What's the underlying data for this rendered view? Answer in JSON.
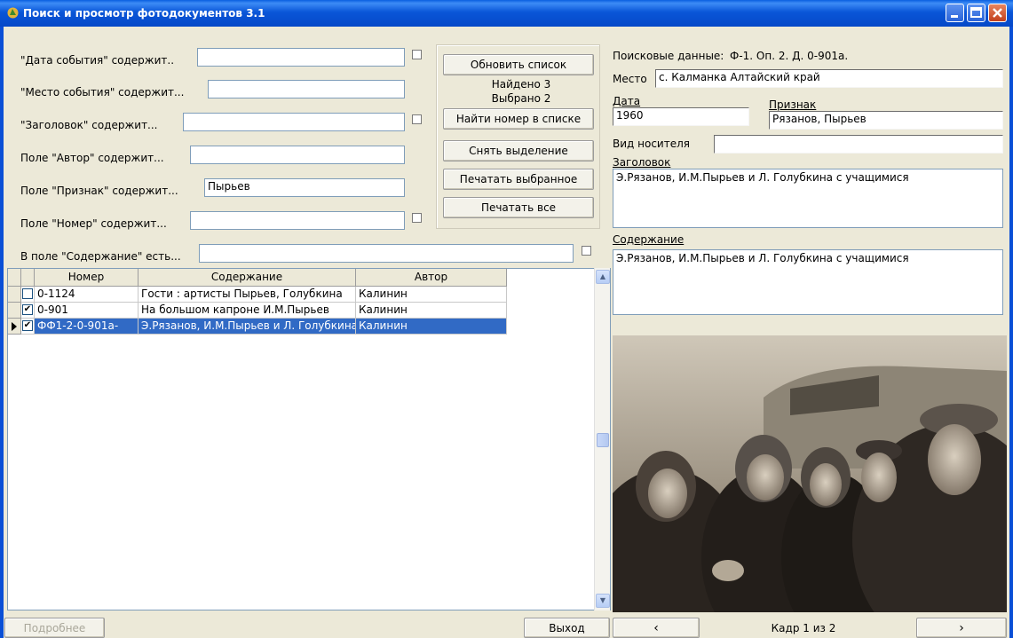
{
  "window": {
    "title": "Поиск и просмотр фотодокументов 3.1"
  },
  "filters": {
    "date_label": "\"Дата события\" содержит..",
    "date_value": "",
    "place_label": "\"Место события\" содержит...",
    "place_value": "",
    "title_label": "\"Заголовок\" содержит...",
    "title_value": "",
    "author_label": "Поле \"Автор\" содержит...",
    "author_value": "",
    "sign_label": "Поле \"Признак\" содержит...",
    "sign_value": "Пырьев",
    "number_label": "Поле \"Номер\" содержит...",
    "number_value": "",
    "content_label": "В поле \"Содержание\" есть...",
    "content_value": ""
  },
  "actions": {
    "refresh_label": "Обновить список",
    "found_text": "Найдено 3",
    "selected_text": "Выбрано 2",
    "find_number_label": "Найти номер в списке",
    "deselect_label": "Снять выделение",
    "print_selected_label": "Печатать выбранное",
    "print_all_label": "Печатать все"
  },
  "grid": {
    "columns": [
      "Номер",
      "Содержание",
      "Автор"
    ],
    "rows": [
      {
        "checked": false,
        "current": false,
        "number": "0-1124",
        "content": "Гости : артисты Пырьев, Голубкина",
        "author": "Калинин"
      },
      {
        "checked": true,
        "current": false,
        "number": "0-901",
        "content": "На большом капроне И.М.Пырьев",
        "author": "Калинин"
      },
      {
        "checked": true,
        "current": true,
        "number": "ФФ1-2-0-901а-",
        "content": "Э.Рязанов, И.М.Пырьев и Л. Голубкина",
        "author": "Калинин"
      }
    ]
  },
  "details": {
    "search_data_label": "Поисковые данные:",
    "search_data_value": "Ф-1. Оп. 2. Д. 0-901а.",
    "place_label": "Место",
    "place_value": "с. Калманка Алтайский край",
    "date_label": "Дата",
    "date_value": "1960",
    "sign_label": "Признак",
    "sign_value": "Рязанов, Пырьев",
    "media_label": "Вид носителя",
    "media_value": "",
    "title_label": "Заголовок",
    "title_value": "Э.Рязанов, И.М.Пырьев и Л. Голубкина с учащимися",
    "content_label": "Содержание",
    "content_value": "Э.Рязанов, И.М.Пырьев и Л. Голубкина с учащимися"
  },
  "footer": {
    "more_label": "Подробнее",
    "exit_label": "Выход",
    "prev_label": "‹",
    "next_label": "›",
    "frame_text": "Кадр 1 из 2"
  },
  "colors": {
    "title_bar": "#0a56d8",
    "selection": "#316ac5",
    "dialog_bg": "#ece9d8"
  }
}
